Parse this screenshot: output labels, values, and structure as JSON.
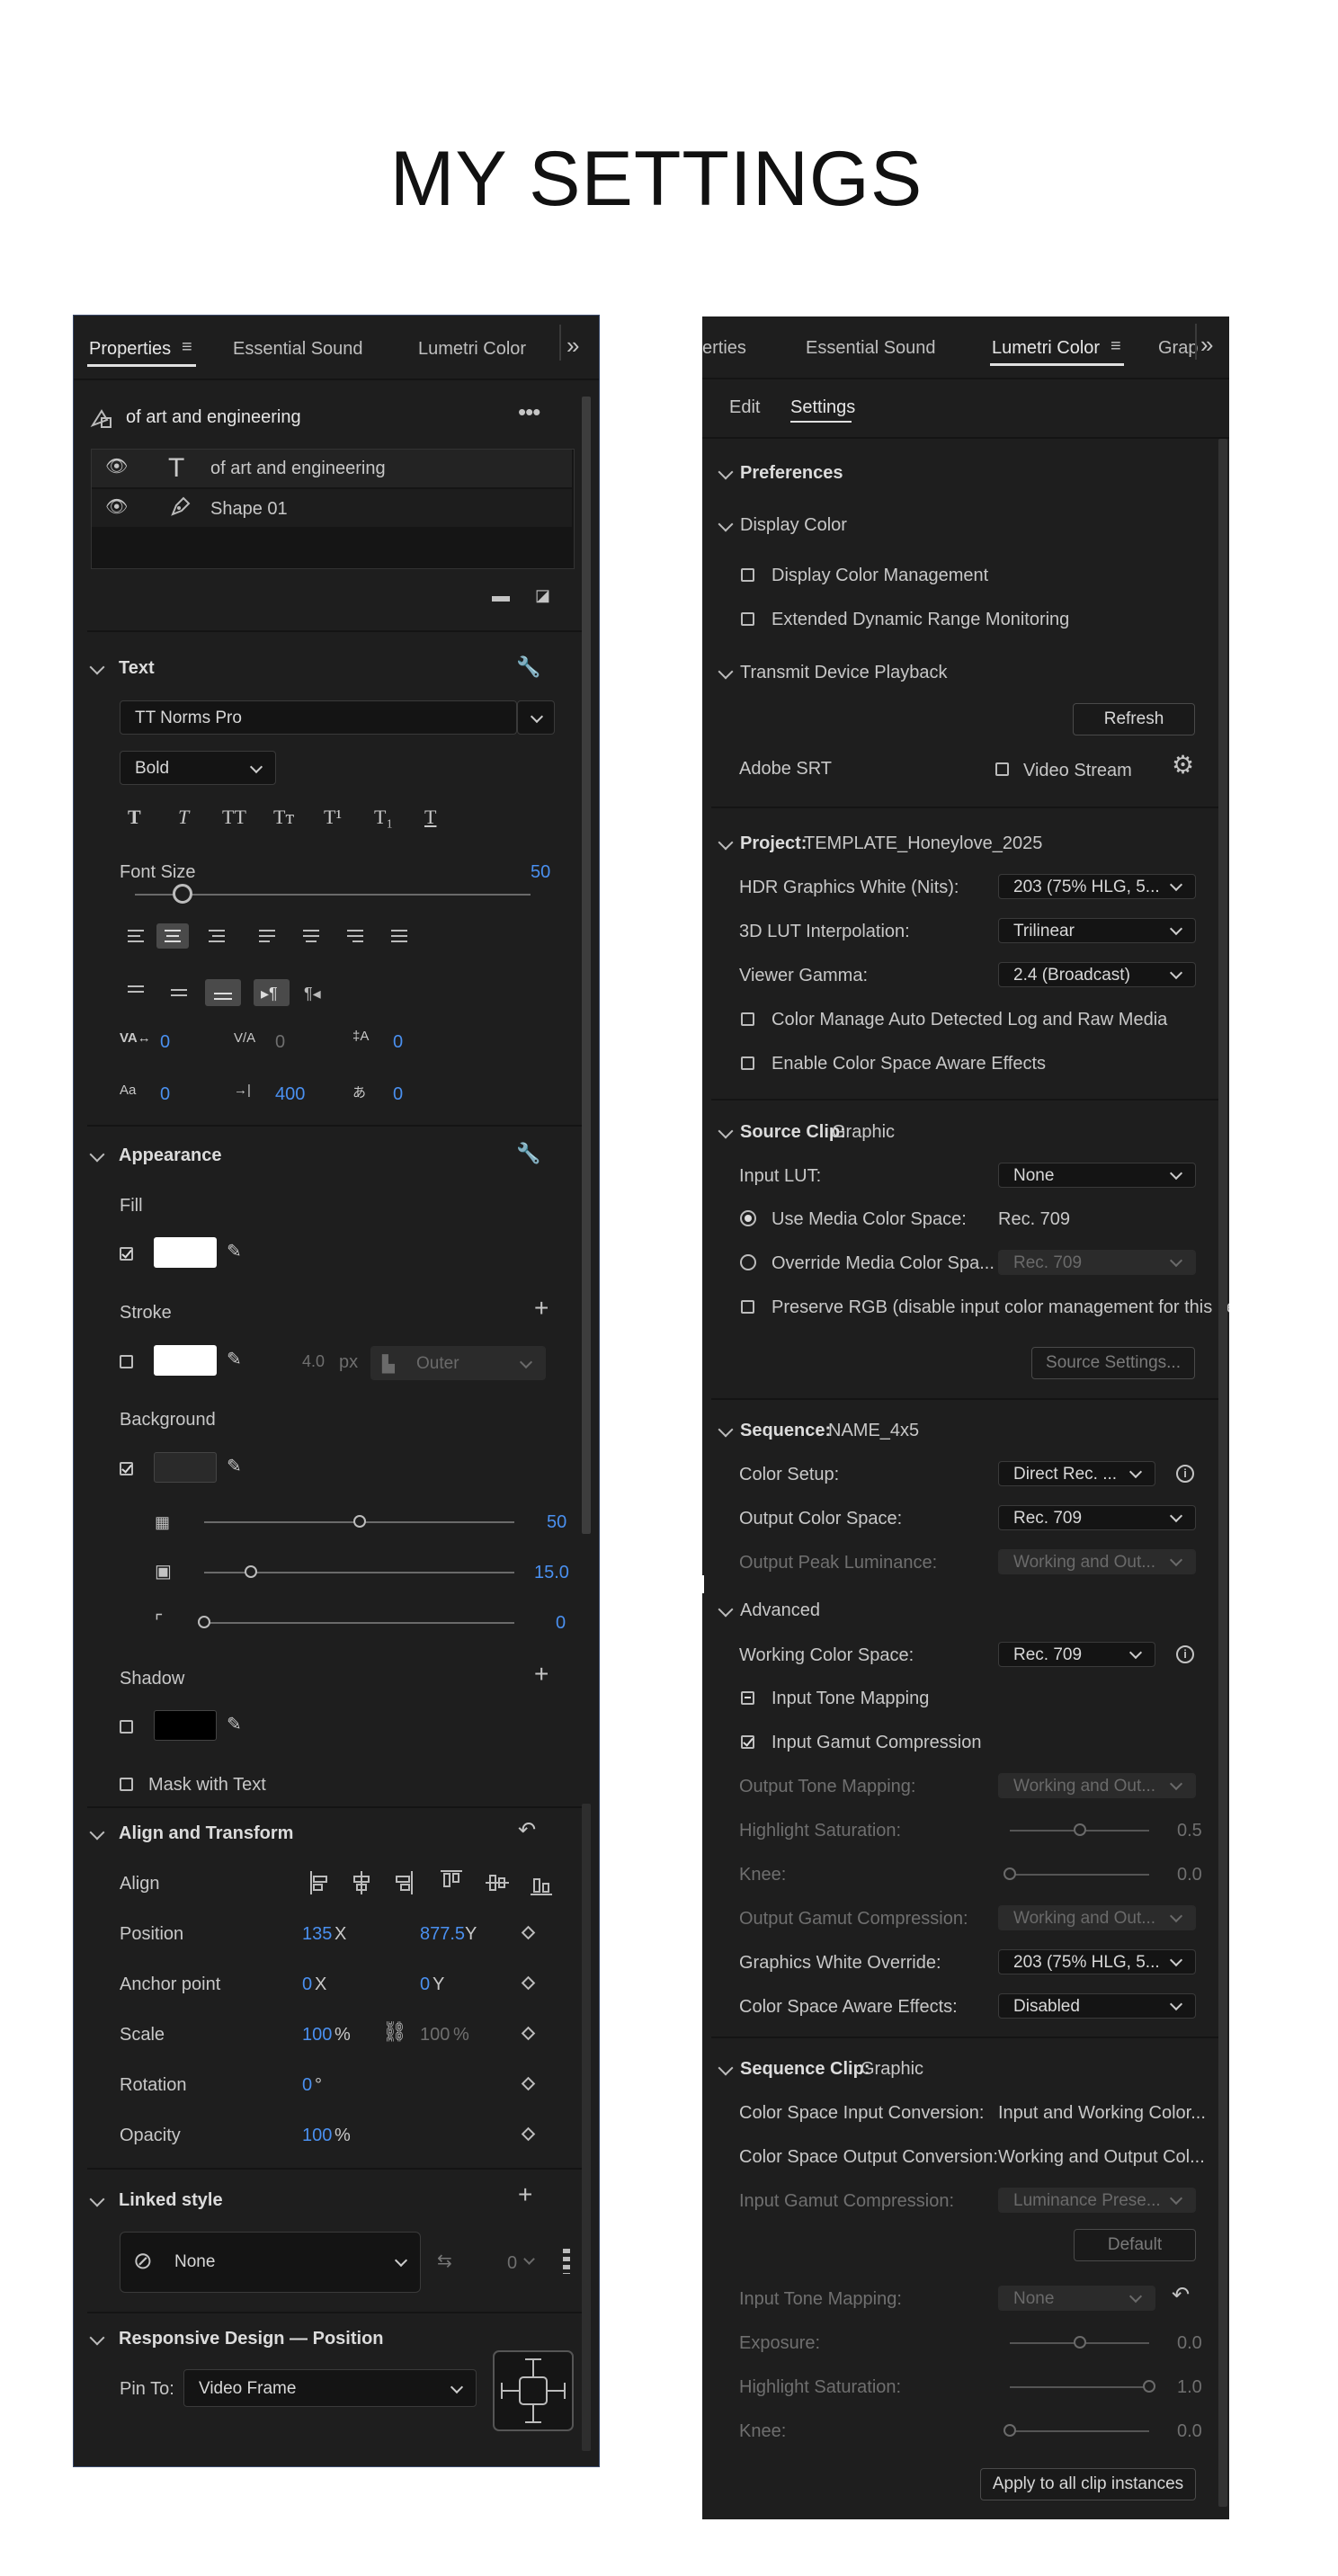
{
  "page_title": "MY SETTINGS",
  "left": {
    "tabs": [
      "Properties",
      "Essential Sound",
      "Lumetri Color"
    ],
    "layer_header": "of art and engineering",
    "layers": [
      {
        "name": "of art and engineering",
        "type": "text"
      },
      {
        "name": "Shape 01",
        "type": "shape"
      }
    ],
    "text_section": {
      "title": "Text",
      "font": "TT Norms Pro",
      "style": "Bold",
      "style_buttons": [
        "T",
        "T",
        "TT",
        "Tт",
        "T¹",
        "T₁",
        "T"
      ],
      "font_size_label": "Font Size",
      "font_size": "50",
      "font_size_fraction": 0.12,
      "tracking": "0",
      "kerning": "0",
      "baseline": "0",
      "tsume": "0",
      "tab_width": "400",
      "leading": "0"
    },
    "appearance": {
      "title": "Appearance",
      "fill_label": "Fill",
      "fill_color": "#ffffff",
      "stroke_label": "Stroke",
      "stroke_color": "#ffffff",
      "stroke_width": "4.0",
      "stroke_unit": "px",
      "stroke_type": "Outer",
      "background_label": "Background",
      "bg_opacity": "50",
      "bg_opacity_fraction": 0.5,
      "bg_size": "15.0",
      "bg_size_fraction": 0.15,
      "bg_corner": "0",
      "shadow_label": "Shadow",
      "shadow_color": "#000000",
      "mask_label": "Mask with Text"
    },
    "align_transform": {
      "title": "Align and Transform",
      "align_label": "Align",
      "position_label": "Position",
      "position_x": "135",
      "position_y": "877.5",
      "anchor_label": "Anchor point",
      "anchor_x": "0",
      "anchor_y": "0",
      "scale_label": "Scale",
      "scale": "100",
      "scale_linked": "100",
      "rotation_label": "Rotation",
      "rotation": "0",
      "opacity_label": "Opacity",
      "opacity": "100",
      "x_label": "X",
      "y_label": "Y",
      "pct": "%",
      "deg": "°"
    },
    "linked_style": {
      "title": "Linked style",
      "value": "None",
      "count": "0"
    },
    "responsive": {
      "title": "Responsive Design — Position",
      "pin_label": "Pin To:",
      "pin_value": "Video Frame"
    }
  },
  "right": {
    "tabs": [
      "erties",
      "Essential Sound",
      "Lumetri Color",
      "Grap"
    ],
    "subtabs": [
      "Edit",
      "Settings"
    ],
    "preferences": "Preferences",
    "display_color": "Display Color",
    "display_color_mgmt": "Display Color Management",
    "edr_monitoring": "Extended Dynamic Range Monitoring",
    "transmit": "Transmit Device Playback",
    "refresh": "Refresh",
    "adobe_srt": "Adobe SRT",
    "video_stream": "Video Stream",
    "project_label": "Project:",
    "project_name": "TEMPLATE_Honeylove_2025",
    "hdr_white_label": "HDR Graphics White (Nits):",
    "hdr_white": "203 (75% HLG, 5...",
    "lut_interp_label": "3D LUT Interpolation:",
    "lut_interp": "Trilinear",
    "viewer_gamma_label": "Viewer Gamma:",
    "viewer_gamma": "2.4 (Broadcast)",
    "color_manage_auto": "Color Manage Auto Detected Log and Raw Media",
    "color_space_aware": "Enable Color Space Aware Effects",
    "source_clip_label": "Source Clip:",
    "source_clip_name": "Graphic",
    "input_lut_label": "Input LUT:",
    "input_lut": "None",
    "use_media_cs": "Use Media Color Space:",
    "use_media_cs_value": "Rec. 709",
    "override_media_cs": "Override Media Color Spa...",
    "override_value": "Rec. 709",
    "preserve_rgb": "Preserve RGB (disable input color management for this item",
    "source_settings": "Source Settings...",
    "sequence_label": "Sequence:",
    "sequence_name": "NAME_4x5",
    "color_setup_label": "Color Setup:",
    "color_setup": "Direct Rec. ...",
    "output_cs_label": "Output Color Space:",
    "output_cs": "Rec. 709",
    "output_peak_label": "Output Peak Luminance:",
    "output_peak": "Working and Out...",
    "advanced": "Advanced",
    "working_cs_label": "Working Color Space:",
    "working_cs": "Rec. 709",
    "input_tone_mapping": "Input Tone Mapping",
    "input_gamut_compression": "Input Gamut Compression",
    "output_tone_label": "Output Tone Mapping:",
    "output_tone": "Working and Out...",
    "highlight_sat_label": "Highlight Saturation:",
    "highlight_sat": "0.5",
    "highlight_sat_fraction": 0.5,
    "knee_label": "Knee:",
    "knee": "0.0",
    "output_gamut_label": "Output Gamut Compression:",
    "output_gamut": "Working and Out...",
    "graphics_white_label": "Graphics White Override:",
    "graphics_white": "203 (75% HLG, 5...",
    "cs_aware_label": "Color Space Aware Effects:",
    "cs_aware": "Disabled",
    "seq_clip_label": "Sequence Clip:",
    "seq_clip_name": "Graphic",
    "cs_input_conv_label": "Color Space Input Conversion:",
    "cs_input_conv": "Input and Working Color...",
    "cs_output_conv_label": "Color Space Output Conversion:",
    "cs_output_conv": "Working and Output Col...",
    "input_gamut_label": "Input Gamut Compression:",
    "input_gamut": "Luminance Prese...",
    "default_btn": "Default",
    "input_tone_label": "Input Tone Mapping:",
    "input_tone": "None",
    "exposure_label": "Exposure:",
    "exposure": "0.0",
    "exposure_fraction": 0.5,
    "clip_highlight_label": "Highlight Saturation:",
    "clip_highlight": "1.0",
    "clip_highlight_fraction": 1.0,
    "clip_knee_label": "Knee:",
    "clip_knee": "0.0",
    "apply_all": "Apply to all clip instances"
  }
}
